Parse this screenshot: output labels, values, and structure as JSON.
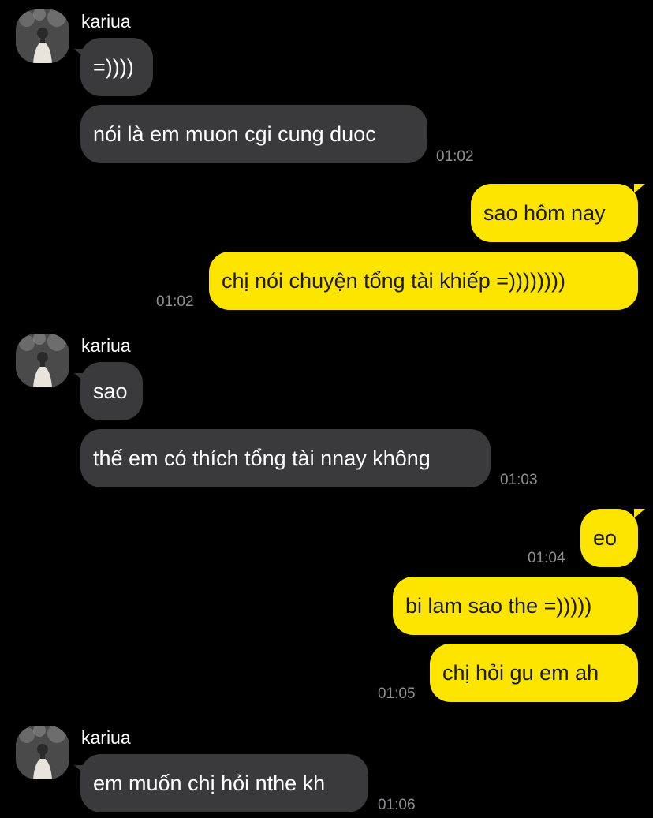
{
  "messages": [
    {
      "sender": "kariua",
      "text": "=))))"
    },
    {
      "text": "nói là em muon cgi cung duoc",
      "time": "01:02"
    },
    {
      "text": "sao hôm nay"
    },
    {
      "text": "chị nói chuyện tổng tài khiếp =))))))))",
      "time": "01:02"
    },
    {
      "sender": "kariua",
      "text": "sao"
    },
    {
      "text": "thế em có thích tổng tài nnay không",
      "time": "01:03"
    },
    {
      "text": "eo",
      "time": "01:04"
    },
    {
      "text": "bi lam sao the =)))))"
    },
    {
      "text": "chị hỏi gu em ah",
      "time": "01:05"
    },
    {
      "sender": "kariua",
      "text": "em muốn chị hỏi nthe kh",
      "time": "01:06"
    }
  ],
  "colors": {
    "background": "#000000",
    "incoming_bubble": "#3a3a3c",
    "outgoing_bubble": "#fee500",
    "timestamp": "#8e8e93"
  },
  "icons": {
    "avatar": "user-avatar-photo"
  }
}
